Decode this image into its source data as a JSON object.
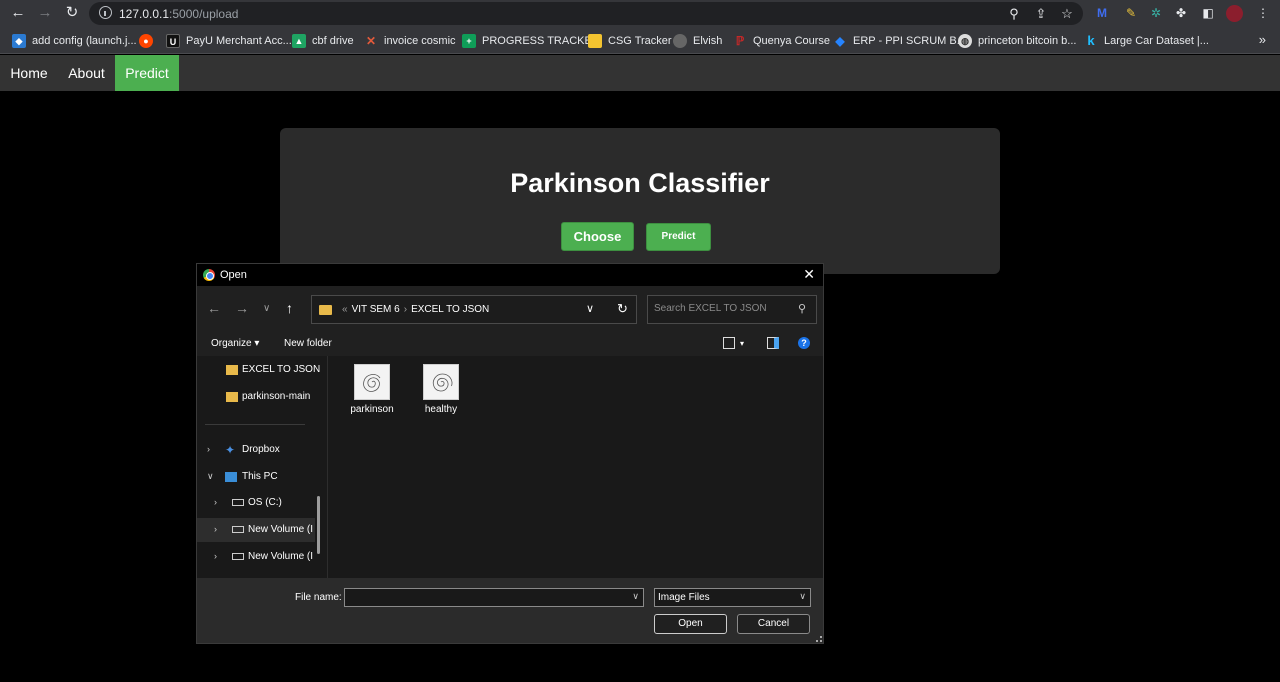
{
  "browser": {
    "url_host": "127.0.0.1",
    "url_rest": ":5000/upload",
    "bookmarks": [
      {
        "label": "add config (launch.j...",
        "icon": "vscode-icon",
        "color": "#2b7ad1"
      },
      {
        "label": "",
        "icon": "reddit-icon",
        "color": "#ff4500"
      },
      {
        "label": "PayU Merchant Acc...",
        "icon": "payu-icon",
        "color": "#111111"
      },
      {
        "label": "cbf drive",
        "icon": "google-drive-icon",
        "color": "#1fa463"
      },
      {
        "label": "invoice cosmic",
        "icon": "cosmic-icon",
        "color": "#e25a3b"
      },
      {
        "label": "PROGRESS TRACKE...",
        "icon": "sheets-icon",
        "color": "#0f9d58"
      },
      {
        "label": "CSG Tracker",
        "icon": "note-icon",
        "color": "#f4c430"
      },
      {
        "label": "Elvish",
        "icon": "elvish-icon",
        "color": "#666666"
      },
      {
        "label": "Quenya Course",
        "icon": "quenya-icon",
        "color": "#c62828"
      },
      {
        "label": "ERP - PPI SCRUM B...",
        "icon": "jira-icon",
        "color": "#2684ff"
      },
      {
        "label": "princeton bitcoin b...",
        "icon": "globe-icon",
        "color": "#dddddd"
      },
      {
        "label": "Large Car Dataset |...",
        "icon": "kaggle-icon",
        "color": "#20beff"
      }
    ],
    "more_bookmarks": "»"
  },
  "site": {
    "nav": [
      "Home",
      "About",
      "Predict"
    ],
    "title": "Parkinson Classifier",
    "choose_label": "Choose",
    "predict_label": "Predict"
  },
  "dialog": {
    "title": "Open",
    "close": "✕",
    "breadcrumb_prefix": "«",
    "breadcrumb": [
      "VIT SEM 6",
      "EXCEL TO JSON"
    ],
    "search_placeholder": "Search EXCEL TO JSON",
    "organize_label": "Organize ▾",
    "new_folder_label": "New folder",
    "tree": [
      {
        "label": "EXCEL TO JSON",
        "icon": "folder-icon"
      },
      {
        "label": "parkinson-main",
        "icon": "folder-icon"
      },
      {
        "label": "Dropbox",
        "icon": "dropbox-icon"
      },
      {
        "label": "This PC",
        "icon": "pc-icon"
      },
      {
        "label": "OS (C:)",
        "icon": "drive-icon"
      },
      {
        "label": "New Volume (I",
        "icon": "drive-icon"
      },
      {
        "label": "New Volume (I",
        "icon": "drive-icon"
      }
    ],
    "files": [
      {
        "name": "parkinson"
      },
      {
        "name": "healthy"
      }
    ],
    "file_name_label": "File name:",
    "file_name_value": "",
    "file_type": "Image Files",
    "open_label": "Open",
    "cancel_label": "Cancel"
  }
}
